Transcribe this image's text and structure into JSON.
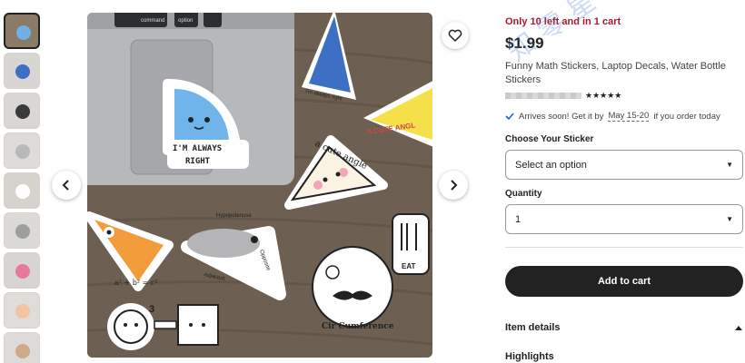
{
  "gallery": {
    "thumbnails": [
      {
        "bg": "#8a7a66",
        "accent": "#6fb0e6",
        "active": true
      },
      {
        "bg": "#d8d6d2",
        "accent": "#3d6fc4"
      },
      {
        "bg": "#d9d7d3",
        "accent": "#3a3a3a"
      },
      {
        "bg": "#dedcd8",
        "accent": "#b9b9b9"
      },
      {
        "bg": "#d6d3cf",
        "accent": "#ffffff"
      },
      {
        "bg": "#dcdad6",
        "accent": "#9e9e9e"
      },
      {
        "bg": "#d7d5d1",
        "accent": "#e77a9a"
      },
      {
        "bg": "#dfddd9",
        "accent": "#f2c4a0"
      },
      {
        "bg": "#dddbd7",
        "accent": "#d0a98a"
      }
    ],
    "stickers": {
      "right_angle": "I'M ALWAYS\nRIGHT",
      "cute_angle": "a cute angle",
      "obtuse": "A CUTE ANGL",
      "hyp": "Hypopotenuse",
      "adjacent": "Adjacent",
      "opposite": "Opposite",
      "pythag": "a² + b² = c²",
      "circ": "Cir Cumference",
      "eat": "EAT",
      "cone_small": "I'm always right",
      "keys": [
        "command",
        "option",
        "so"
      ]
    }
  },
  "listing": {
    "stock_text": "Only 10 left and in 1 cart",
    "price": "$1.99",
    "title": "Funny Math Stickers, Laptop Decals, Water Bottle Stickers",
    "stars": "★★★★★",
    "arrives_prefix": "Arrives soon! Get it by",
    "arrives_dates": "May 15-20",
    "arrives_suffix": "if you order today",
    "sticker_label": "Choose Your Sticker",
    "sticker_value": "Select an option",
    "quantity_label": "Quantity",
    "quantity_value": "1",
    "add_to_cart": "Add to cart",
    "item_details": "Item details",
    "highlights": "Highlights"
  },
  "watermark_text": "知 零 星 球",
  "colors": {
    "stock": "#a61a2e",
    "button": "#222222",
    "sticker_blue": "#6fb4ea",
    "sticker_yellow": "#f5e04a",
    "sticker_orange": "#f29b3a"
  }
}
